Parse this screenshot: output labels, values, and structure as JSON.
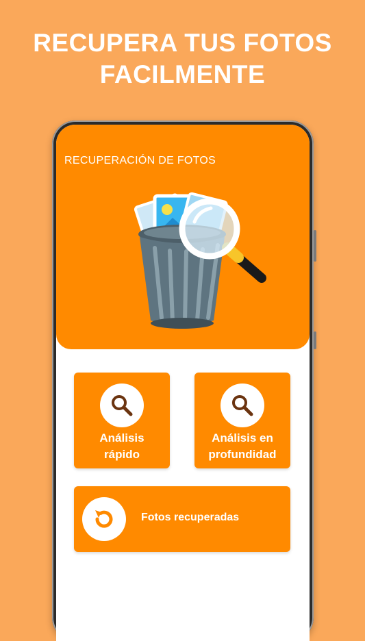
{
  "promo": {
    "title_line1": "RECUPERA TUS FOTOS",
    "title_line2": "FACILMENTE"
  },
  "app": {
    "title": "RECUPERACIÓN DE FOTOS"
  },
  "actions": {
    "quick_scan": {
      "line1": "Análisis",
      "line2": "rápido",
      "icon": "search-icon"
    },
    "deep_scan": {
      "line1": "Análisis en",
      "line2": "profundidad",
      "icon": "search-icon"
    },
    "recovered": {
      "label": "Fotos recuperadas",
      "icon": "restore-icon"
    }
  },
  "colors": {
    "background": "#FAA85A",
    "accent": "#FF8A00",
    "icon_brown": "#6B3410",
    "trash_gray": "#5E7480"
  }
}
